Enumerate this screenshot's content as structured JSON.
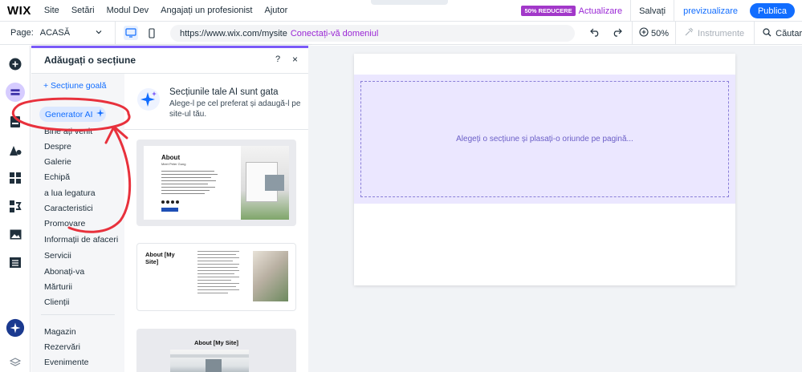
{
  "app": {
    "logo": "WIX",
    "menu": [
      "Site",
      "Setări",
      "Modul Dev",
      "Angajați un profesionist",
      "Ajutor"
    ],
    "promo_badge": "50% REDUCERE",
    "upgrade": "Actualizare",
    "save": "Salvați",
    "preview": "previzualizare",
    "publish": "Publica"
  },
  "toolbar": {
    "page_label": "Page:",
    "page_name": "ACASĂ",
    "url": "https://www.wix.com/mysite",
    "connect_domain": "Conectați-vă domeniul",
    "zoom": "50%",
    "tools": "Instrumente",
    "search": "Căutare"
  },
  "panel": {
    "title": "Adăugați o secțiune",
    "help": "?",
    "close": "×",
    "empty_section": "+ Secțiune goală",
    "ai_generator": "Generator AI",
    "categories": [
      "Bine ați venit",
      "Despre",
      "Galerie",
      "Echipă",
      "a lua legatura",
      "Caracteristici",
      "Promovare",
      "Informații de afaceri",
      "Servicii",
      "Abonați-va",
      "Mărturii",
      "Clienții"
    ],
    "categories_2": [
      "Magazin",
      "Rezervări",
      "Evenimente"
    ],
    "ai_banner": {
      "title": "Secțiunile tale AI sunt gata",
      "text": "Alege-l pe cel preferat și adaugă-l pe site-ul tău."
    },
    "thumbs": [
      {
        "title": "About",
        "subtitle": "Meet Peter Gung"
      },
      {
        "title": "About [My Site]"
      },
      {
        "title": "About [My Site]"
      }
    ]
  },
  "canvas": {
    "drop_hint": "Alegeți o secțiune și plasați-o oriunde pe pagină..."
  },
  "colors": {
    "accent": "#116dff",
    "purple": "#9a27d5",
    "dropzone": "#ebe7ff",
    "annotation": "#e8313c"
  }
}
